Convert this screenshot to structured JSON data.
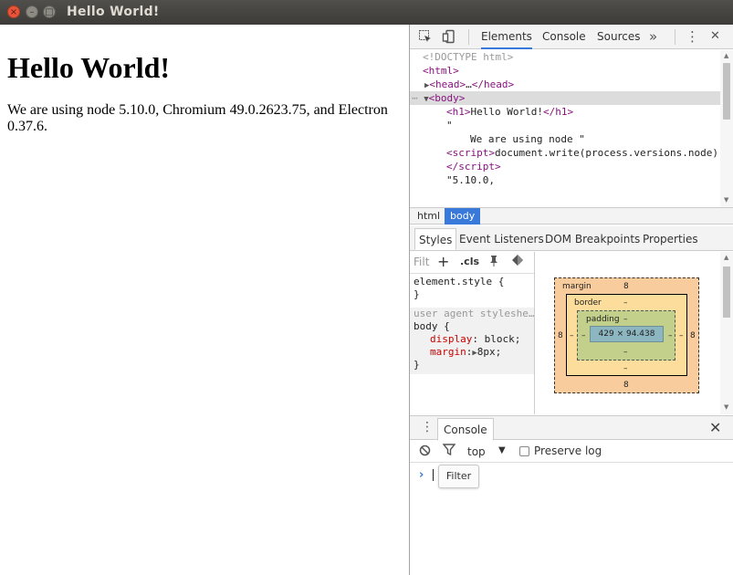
{
  "window": {
    "title": "Hello World!",
    "close_glyph": "×",
    "min_glyph": "–",
    "max_glyph": "□"
  },
  "page": {
    "heading": "Hello World!",
    "paragraph": "We are using node 5.10.0, Chromium 49.0.2623.75, and Electron 0.37.6."
  },
  "devtools": {
    "tabs": [
      "Elements",
      "Console",
      "Sources"
    ],
    "active_tab": "Elements",
    "more_glyph": "»",
    "menu_glyph": "⋮",
    "close_glyph": "✕",
    "tree": {
      "doctype": "<!DOCTYPE html>",
      "html_open": "html",
      "head_open": "head",
      "head_ellipsis": "…",
      "head_close": "/head",
      "body_open": "body",
      "h1_open": "h1",
      "h1_text": "Hello World!",
      "h1_close": "/h1",
      "quote_open": "\"",
      "text_node": "We are using node \"",
      "script_open": "script",
      "script_text": "document.write(process.versions.node)",
      "script_close": "/script",
      "version_text": "\"5.10.0,"
    },
    "breadcrumbs": [
      "html",
      "body"
    ],
    "breadcrumb_active": "body",
    "styles_tabs": [
      "Styles",
      "Event Listeners",
      "DOM Breakpoints",
      "Properties"
    ],
    "styles_active": "Styles",
    "styles_toolbar": {
      "filter_placeholder": "Filt",
      "add": "+",
      "cls": ".cls"
    },
    "rules": {
      "element_style": "element.style {",
      "close_brace": "}",
      "ua_header": "user agent styleshe…",
      "ua_selector": "body {",
      "prop1": "display",
      "val1": "block;",
      "prop2": "margin",
      "val2": "8px;"
    },
    "box_model": {
      "margin_label": "margin",
      "margin_top": "8",
      "margin_bottom": "8",
      "margin_left": "8",
      "margin_right": "8",
      "border_label": "border",
      "border_top": "–",
      "border_bottom": "–",
      "border_left": "–",
      "border_right": "–",
      "padding_label": "padding",
      "padding_top": "–",
      "padding_bottom": "–",
      "padding_left": "–",
      "padding_right": "–",
      "content": "429 × 94.438"
    },
    "console": {
      "tab": "Console",
      "context": "top",
      "preserve_log": "Preserve log",
      "prompt": "›",
      "tooltip": "Filter"
    }
  }
}
